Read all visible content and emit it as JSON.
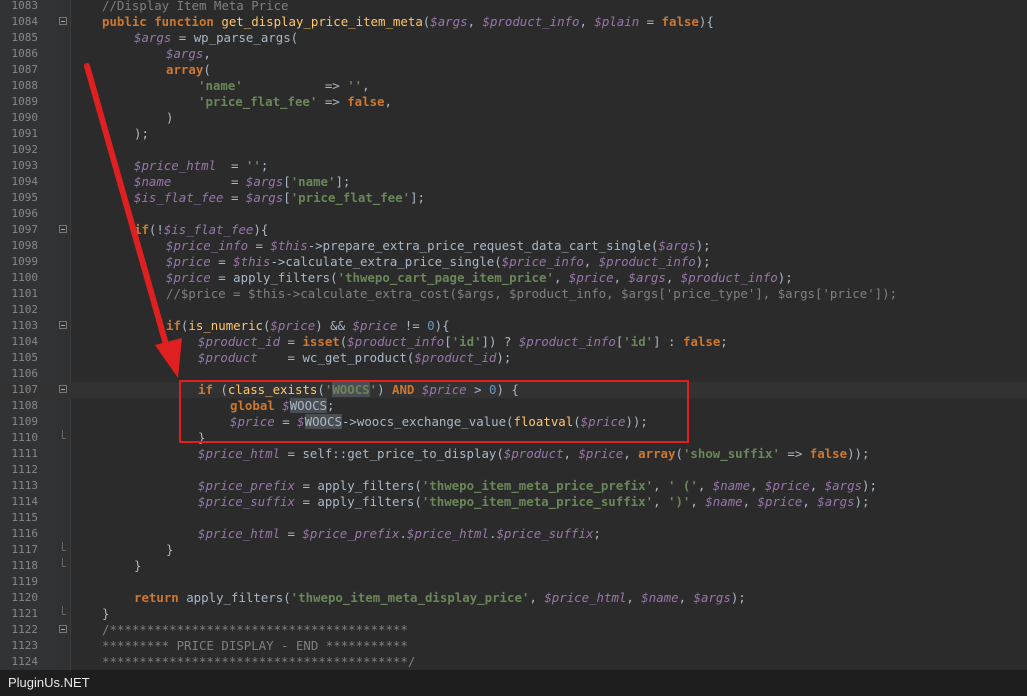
{
  "editor": {
    "lines": [
      {
        "n": "1083",
        "fold": "",
        "ind": 0,
        "t": [
          [
            "com",
            "//Display Item Meta Price"
          ]
        ]
      },
      {
        "n": "1084",
        "fold": "open",
        "ind": 0,
        "t": [
          [
            "kw",
            "public function "
          ],
          [
            "fn",
            "get_display_price_item_meta"
          ],
          [
            "id",
            "("
          ],
          [
            "var",
            "$args"
          ],
          [
            "id",
            ", "
          ],
          [
            "var",
            "$product_info"
          ],
          [
            "id",
            ", "
          ],
          [
            "var",
            "$plain"
          ],
          [
            "id",
            " = "
          ],
          [
            "kw",
            "false"
          ],
          [
            "id",
            "){"
          ]
        ]
      },
      {
        "n": "1085",
        "fold": "",
        "ind": 1,
        "t": [
          [
            "var",
            "$args"
          ],
          [
            "id",
            " = "
          ],
          [
            "id",
            "wp_parse_args("
          ]
        ]
      },
      {
        "n": "1086",
        "fold": "",
        "ind": 2,
        "t": [
          [
            "var",
            "$args"
          ],
          [
            "id",
            ","
          ]
        ]
      },
      {
        "n": "1087",
        "fold": "",
        "ind": 2,
        "t": [
          [
            "kw",
            "array"
          ],
          [
            "id",
            "("
          ]
        ]
      },
      {
        "n": "1088",
        "fold": "",
        "ind": 3,
        "t": [
          [
            "str",
            "'name'"
          ],
          [
            "id",
            "           => "
          ],
          [
            "str",
            "''"
          ],
          [
            "id",
            ","
          ]
        ]
      },
      {
        "n": "1089",
        "fold": "",
        "ind": 3,
        "t": [
          [
            "str",
            "'price_flat_fee'"
          ],
          [
            "id",
            " => "
          ],
          [
            "kw",
            "false"
          ],
          [
            "id",
            ","
          ]
        ]
      },
      {
        "n": "1090",
        "fold": "",
        "ind": 2,
        "t": [
          [
            "id",
            ")"
          ]
        ]
      },
      {
        "n": "1091",
        "fold": "",
        "ind": 1,
        "t": [
          [
            "id",
            ");"
          ]
        ]
      },
      {
        "n": "1092",
        "fold": "",
        "ind": 0,
        "t": []
      },
      {
        "n": "1093",
        "fold": "",
        "ind": 1,
        "t": [
          [
            "var",
            "$price_html"
          ],
          [
            "id",
            "  = "
          ],
          [
            "str",
            "''"
          ],
          [
            "id",
            ";"
          ]
        ]
      },
      {
        "n": "1094",
        "fold": "",
        "ind": 1,
        "t": [
          [
            "var",
            "$name"
          ],
          [
            "id",
            "        = "
          ],
          [
            "var",
            "$args"
          ],
          [
            "id",
            "["
          ],
          [
            "str",
            "'name'"
          ],
          [
            "id",
            "];"
          ]
        ]
      },
      {
        "n": "1095",
        "fold": "",
        "ind": 1,
        "t": [
          [
            "var",
            "$is_flat_fee"
          ],
          [
            "id",
            " = "
          ],
          [
            "var",
            "$args"
          ],
          [
            "id",
            "["
          ],
          [
            "str",
            "'price_flat_fee'"
          ],
          [
            "id",
            "];"
          ]
        ]
      },
      {
        "n": "1096",
        "fold": "",
        "ind": 0,
        "t": []
      },
      {
        "n": "1097",
        "fold": "open",
        "ind": 1,
        "t": [
          [
            "kw",
            "if"
          ],
          [
            "id",
            "(!"
          ],
          [
            "var",
            "$is_flat_fee"
          ],
          [
            "id",
            "){"
          ]
        ]
      },
      {
        "n": "1098",
        "fold": "",
        "ind": 2,
        "t": [
          [
            "var",
            "$price_info"
          ],
          [
            "id",
            " = "
          ],
          [
            "var",
            "$this"
          ],
          [
            "id",
            "->prepare_extra_price_request_data_cart_single("
          ],
          [
            "var",
            "$args"
          ],
          [
            "id",
            ");"
          ]
        ]
      },
      {
        "n": "1099",
        "fold": "",
        "ind": 2,
        "t": [
          [
            "var",
            "$price"
          ],
          [
            "id",
            " = "
          ],
          [
            "var",
            "$this"
          ],
          [
            "id",
            "->calculate_extra_price_single("
          ],
          [
            "var",
            "$price_info"
          ],
          [
            "id",
            ", "
          ],
          [
            "var",
            "$product_info"
          ],
          [
            "id",
            ");"
          ]
        ]
      },
      {
        "n": "1100",
        "fold": "",
        "ind": 2,
        "t": [
          [
            "var",
            "$price"
          ],
          [
            "id",
            " = "
          ],
          [
            "id",
            "apply_filters("
          ],
          [
            "str",
            "'thwepo_cart_page_item_price'"
          ],
          [
            "id",
            ", "
          ],
          [
            "var",
            "$price"
          ],
          [
            "id",
            ", "
          ],
          [
            "var",
            "$args"
          ],
          [
            "id",
            ", "
          ],
          [
            "var",
            "$product_info"
          ],
          [
            "id",
            ");"
          ]
        ]
      },
      {
        "n": "1101",
        "fold": "",
        "ind": 2,
        "t": [
          [
            "com",
            "//$price = $this->calculate_extra_cost($args, $product_info, $args['price_type'], $args['price']);"
          ]
        ]
      },
      {
        "n": "1102",
        "fold": "",
        "ind": 0,
        "t": []
      },
      {
        "n": "1103",
        "fold": "open",
        "ind": 2,
        "t": [
          [
            "kw",
            "if"
          ],
          [
            "id",
            "("
          ],
          [
            "fn",
            "is_numeric"
          ],
          [
            "id",
            "("
          ],
          [
            "var",
            "$price"
          ],
          [
            "id",
            ") && "
          ],
          [
            "var",
            "$price"
          ],
          [
            "id",
            " != "
          ],
          [
            "num",
            "0"
          ],
          [
            "id",
            "){"
          ]
        ]
      },
      {
        "n": "1104",
        "fold": "",
        "ind": 3,
        "t": [
          [
            "var",
            "$product_id"
          ],
          [
            "id",
            " = "
          ],
          [
            "kw",
            "isset"
          ],
          [
            "id",
            "("
          ],
          [
            "var",
            "$product_info"
          ],
          [
            "id",
            "["
          ],
          [
            "str",
            "'id'"
          ],
          [
            "id",
            "]) ? "
          ],
          [
            "var",
            "$product_info"
          ],
          [
            "id",
            "["
          ],
          [
            "str",
            "'id'"
          ],
          [
            "id",
            "] : "
          ],
          [
            "kw",
            "false"
          ],
          [
            "id",
            ";"
          ]
        ]
      },
      {
        "n": "1105",
        "fold": "",
        "ind": 3,
        "t": [
          [
            "var",
            "$product"
          ],
          [
            "id",
            "    = "
          ],
          [
            "id",
            "wc_get_product("
          ],
          [
            "var",
            "$product_id"
          ],
          [
            "id",
            ");"
          ]
        ]
      },
      {
        "n": "1106",
        "fold": "",
        "ind": 0,
        "t": []
      },
      {
        "n": "1107",
        "fold": "open",
        "ind": 3,
        "cur": true,
        "t": [
          [
            "kw",
            "if"
          ],
          [
            "id",
            " ("
          ],
          [
            "fn",
            "class_exists"
          ],
          [
            "id",
            "("
          ],
          [
            "str",
            "'"
          ],
          [
            "hlstr",
            "WOOCS"
          ],
          [
            "str",
            "'"
          ],
          [
            "id",
            ") "
          ],
          [
            "kw",
            "AND"
          ],
          [
            "id",
            " "
          ],
          [
            "var",
            "$price"
          ],
          [
            "id",
            " > "
          ],
          [
            "num",
            "0"
          ],
          [
            "id",
            ") {"
          ]
        ]
      },
      {
        "n": "1108",
        "fold": "",
        "ind": 4,
        "t": [
          [
            "kw",
            "global"
          ],
          [
            "id",
            " "
          ],
          [
            "var",
            "$"
          ],
          [
            "hl",
            "WOOCS"
          ],
          [
            "id",
            ";"
          ]
        ]
      },
      {
        "n": "1109",
        "fold": "",
        "ind": 4,
        "t": [
          [
            "var",
            "$price"
          ],
          [
            "id",
            " = "
          ],
          [
            "var",
            "$"
          ],
          [
            "hl",
            "WOOCS"
          ],
          [
            "id",
            "->woocs_exchange_value("
          ],
          [
            "fn",
            "floatval"
          ],
          [
            "id",
            "("
          ],
          [
            "var",
            "$price"
          ],
          [
            "id",
            "));"
          ]
        ]
      },
      {
        "n": "1110",
        "fold": "end",
        "ind": 3,
        "t": [
          [
            "id",
            "}"
          ]
        ]
      },
      {
        "n": "1111",
        "fold": "",
        "ind": 3,
        "t": [
          [
            "var",
            "$price_html"
          ],
          [
            "id",
            " = self::get_price_to_display("
          ],
          [
            "var",
            "$product"
          ],
          [
            "id",
            ", "
          ],
          [
            "var",
            "$price"
          ],
          [
            "id",
            ", "
          ],
          [
            "kw",
            "array"
          ],
          [
            "id",
            "("
          ],
          [
            "str",
            "'show_suffix'"
          ],
          [
            "id",
            " => "
          ],
          [
            "kw",
            "false"
          ],
          [
            "id",
            "));"
          ]
        ]
      },
      {
        "n": "1112",
        "fold": "",
        "ind": 0,
        "t": []
      },
      {
        "n": "1113",
        "fold": "",
        "ind": 3,
        "t": [
          [
            "var",
            "$price_prefix"
          ],
          [
            "id",
            " = apply_filters("
          ],
          [
            "str",
            "'thwepo_item_meta_price_prefix'"
          ],
          [
            "id",
            ", "
          ],
          [
            "str",
            "' ('"
          ],
          [
            "id",
            ", "
          ],
          [
            "var",
            "$name"
          ],
          [
            "id",
            ", "
          ],
          [
            "var",
            "$price"
          ],
          [
            "id",
            ", "
          ],
          [
            "var",
            "$args"
          ],
          [
            "id",
            ");"
          ]
        ]
      },
      {
        "n": "1114",
        "fold": "",
        "ind": 3,
        "t": [
          [
            "var",
            "$price_suffix"
          ],
          [
            "id",
            " = apply_filters("
          ],
          [
            "str",
            "'thwepo_item_meta_price_suffix'"
          ],
          [
            "id",
            ", "
          ],
          [
            "str",
            "')'"
          ],
          [
            "id",
            ", "
          ],
          [
            "var",
            "$name"
          ],
          [
            "id",
            ", "
          ],
          [
            "var",
            "$price"
          ],
          [
            "id",
            ", "
          ],
          [
            "var",
            "$args"
          ],
          [
            "id",
            ");"
          ]
        ]
      },
      {
        "n": "1115",
        "fold": "",
        "ind": 0,
        "t": []
      },
      {
        "n": "1116",
        "fold": "",
        "ind": 3,
        "t": [
          [
            "var",
            "$price_html"
          ],
          [
            "id",
            " = "
          ],
          [
            "var",
            "$price_prefix"
          ],
          [
            "id",
            "."
          ],
          [
            "var",
            "$price_html"
          ],
          [
            "id",
            "."
          ],
          [
            "var",
            "$price_suffix"
          ],
          [
            "id",
            ";"
          ]
        ]
      },
      {
        "n": "1117",
        "fold": "end",
        "ind": 2,
        "t": [
          [
            "id",
            "}"
          ]
        ]
      },
      {
        "n": "1118",
        "fold": "end",
        "ind": 1,
        "t": [
          [
            "id",
            "}"
          ]
        ]
      },
      {
        "n": "1119",
        "fold": "",
        "ind": 0,
        "t": []
      },
      {
        "n": "1120",
        "fold": "",
        "ind": 1,
        "t": [
          [
            "kw",
            "return"
          ],
          [
            "id",
            " apply_filters("
          ],
          [
            "str",
            "'thwepo_item_meta_display_price'"
          ],
          [
            "id",
            ", "
          ],
          [
            "var",
            "$price_html"
          ],
          [
            "id",
            ", "
          ],
          [
            "var",
            "$name"
          ],
          [
            "id",
            ", "
          ],
          [
            "var",
            "$args"
          ],
          [
            "id",
            ");"
          ]
        ]
      },
      {
        "n": "1121",
        "fold": "end",
        "ind": 0,
        "t": [
          [
            "id",
            "}"
          ]
        ]
      },
      {
        "n": "1122",
        "fold": "open",
        "ind": 0,
        "t": [
          [
            "com",
            "/****************************************"
          ]
        ]
      },
      {
        "n": "1123",
        "fold": "",
        "ind": 0,
        "t": [
          [
            "com",
            "********* PRICE DISPLAY - END ***********"
          ]
        ]
      },
      {
        "n": "1124",
        "fold": "",
        "ind": 0,
        "t": [
          [
            "com",
            "*****************************************/"
          ]
        ]
      }
    ]
  },
  "footer": {
    "label": "PluginUs.NET"
  },
  "colors": {
    "annotation": "#e02020",
    "background": "#2b2b2b"
  }
}
